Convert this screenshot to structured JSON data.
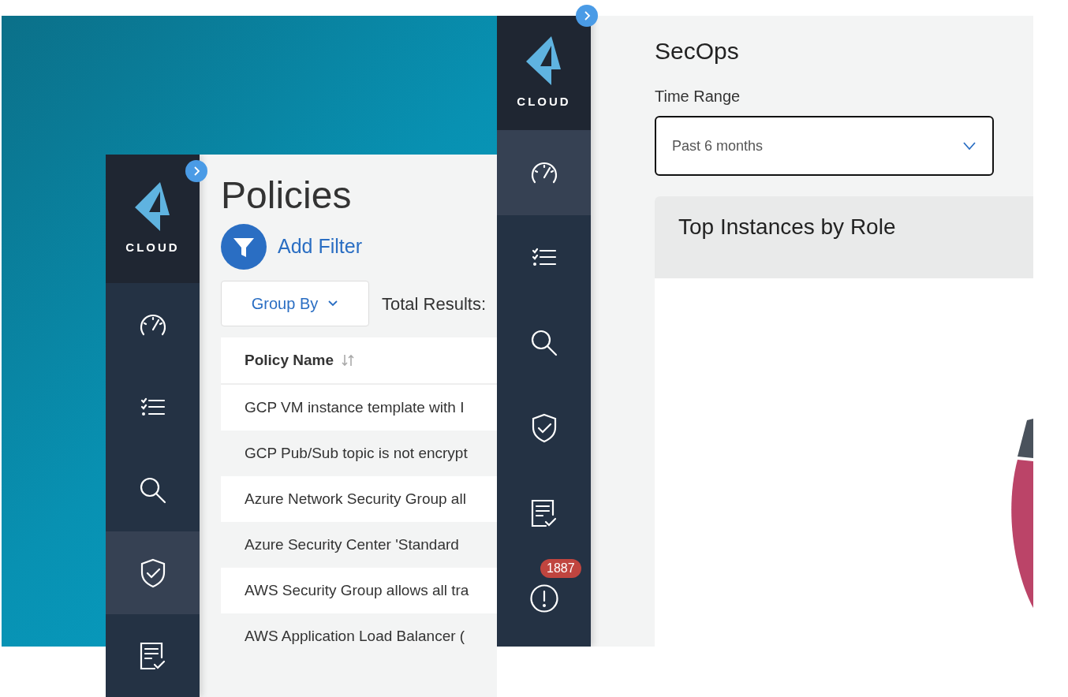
{
  "policies_window": {
    "sidebar": {
      "logo_text": "CLOUD",
      "items": [
        {
          "kind": "dashboard",
          "selected": false
        },
        {
          "kind": "checklist",
          "selected": false
        },
        {
          "kind": "search",
          "selected": false
        },
        {
          "kind": "shield",
          "selected": true
        },
        {
          "kind": "report",
          "selected": false
        }
      ]
    },
    "title": "Policies",
    "add_filter": "Add Filter",
    "group_by": "Group By",
    "total_results": "Total Results:",
    "table": {
      "columns": [
        "Policy Name"
      ],
      "rows": [
        "GCP VM instance template with I",
        "GCP Pub/Sub topic is not encrypt",
        "Azure Network Security Group all",
        "Azure Security Center 'Standard",
        "AWS Security Group allows all tra",
        "AWS Application Load Balancer ("
      ]
    }
  },
  "secops_window": {
    "sidebar": {
      "logo_text": "CLOUD",
      "items": [
        {
          "kind": "dashboard",
          "selected": true
        },
        {
          "kind": "checklist",
          "selected": false
        },
        {
          "kind": "search",
          "selected": false
        },
        {
          "kind": "shield",
          "selected": false
        },
        {
          "kind": "report",
          "selected": false
        },
        {
          "kind": "alert",
          "selected": false,
          "badge": "1887"
        }
      ]
    },
    "title": "SecOps",
    "time_range_label": "Time Range",
    "time_range_value": "Past 6 months",
    "card": {
      "title": "Top Instances by Role"
    }
  }
}
